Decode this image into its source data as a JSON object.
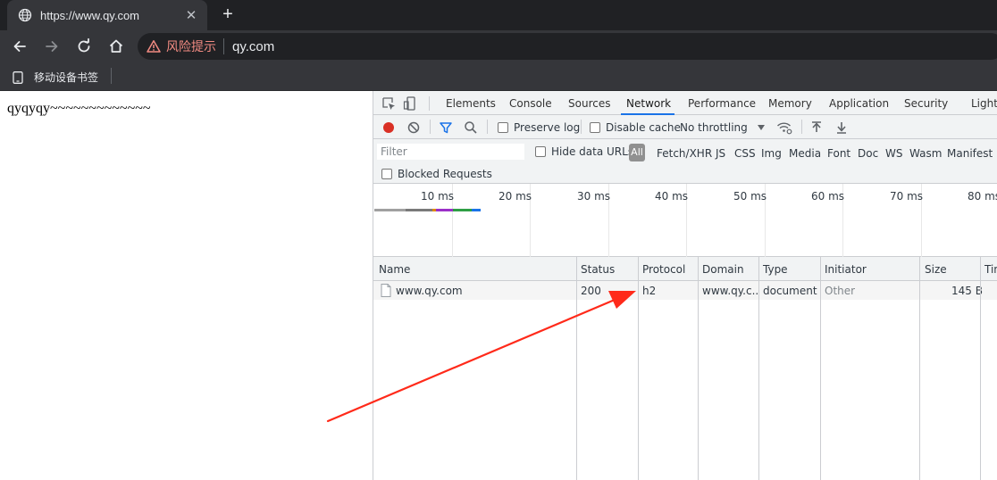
{
  "browser": {
    "tab_title": "https://www.qy.com",
    "tab_close": "✕",
    "new_tab": "+",
    "omnibox_warning": "风险提示",
    "omnibox_url": "qy.com",
    "bookmark_label": "移动设备书签"
  },
  "page": {
    "text": "qyqyqy~~~~~~~~~~~~~"
  },
  "devtools": {
    "tabs": [
      "Elements",
      "Console",
      "Sources",
      "Network",
      "Performance",
      "Memory",
      "Application",
      "Security",
      "Lighthouse"
    ],
    "active_tab": "Network",
    "toolbar": {
      "preserve_log": "Preserve log",
      "disable_cache": "Disable cache",
      "throttling": "No throttling"
    },
    "filter": {
      "placeholder": "Filter",
      "hide_data_urls": "Hide data URLs",
      "all": "All",
      "types": [
        "Fetch/XHR",
        "JS",
        "CSS",
        "Img",
        "Media",
        "Font",
        "Doc",
        "WS",
        "Wasm",
        "Manifest"
      ],
      "blocked_requests": "Blocked Requests"
    },
    "overview_ticks": [
      "10 ms",
      "20 ms",
      "30 ms",
      "40 ms",
      "50 ms",
      "60 ms",
      "70 ms",
      "80 ms"
    ],
    "columns": [
      "Name",
      "Status",
      "Protocol",
      "Domain",
      "Type",
      "Initiator",
      "Size",
      "Time"
    ],
    "rows": [
      {
        "name": "www.qy.com",
        "status": "200",
        "protocol": "h2",
        "domain": "www.qy.c...",
        "type": "document",
        "initiator": "Other",
        "size": "145 B"
      }
    ]
  },
  "colors": {
    "chrome_dark": "#202124",
    "chrome_toolbar": "#35363a",
    "warning_red": "#f28b82",
    "record_red": "#d93025",
    "accent_blue": "#1a73e8",
    "annotation_arrow": "#ff2a1a"
  }
}
